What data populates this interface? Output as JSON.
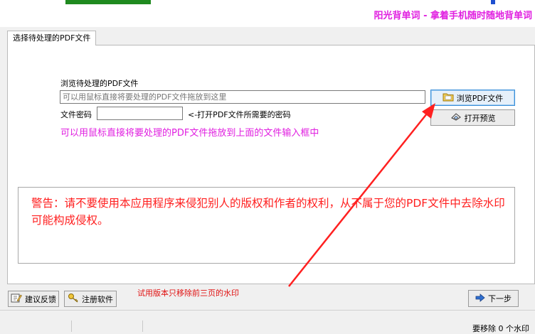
{
  "header": {
    "slogan": "阳光背单词 - 拿着手机随时随地背单词"
  },
  "tab": {
    "label": "选择待处理的PDF文件"
  },
  "file_section": {
    "browse_label": "浏览待处理的PDF文件",
    "file_placeholder": "可以用鼠标直接将要处理的PDF文件拖放到这里",
    "browse_button": "浏览PDF文件",
    "password_label": "文件密码",
    "password_value": "",
    "password_hint": "<-打开PDF文件所需要的密码",
    "preview_button": "打开预览",
    "drag_hint": "可以用鼠标直接将要处理的PDF文件拖放到上面的文件输入框中"
  },
  "warning": {
    "text": "警告：请不要使用本应用程序来侵犯别人的版权和作者的权利，从不属于您的PDF文件中去除水印可能构成侵权。"
  },
  "footer": {
    "feedback_button": "建议反馈",
    "register_button": "注册软件",
    "trial_note": "试用版本只移除前三页的水印",
    "next_button": "下一步"
  },
  "statusbar": {
    "text": "要移除 0 个水印"
  },
  "colors": {
    "accent_magenta": "#e020e0",
    "warning_red": "#ff1e1e",
    "arrow_red": "#ff2020"
  }
}
